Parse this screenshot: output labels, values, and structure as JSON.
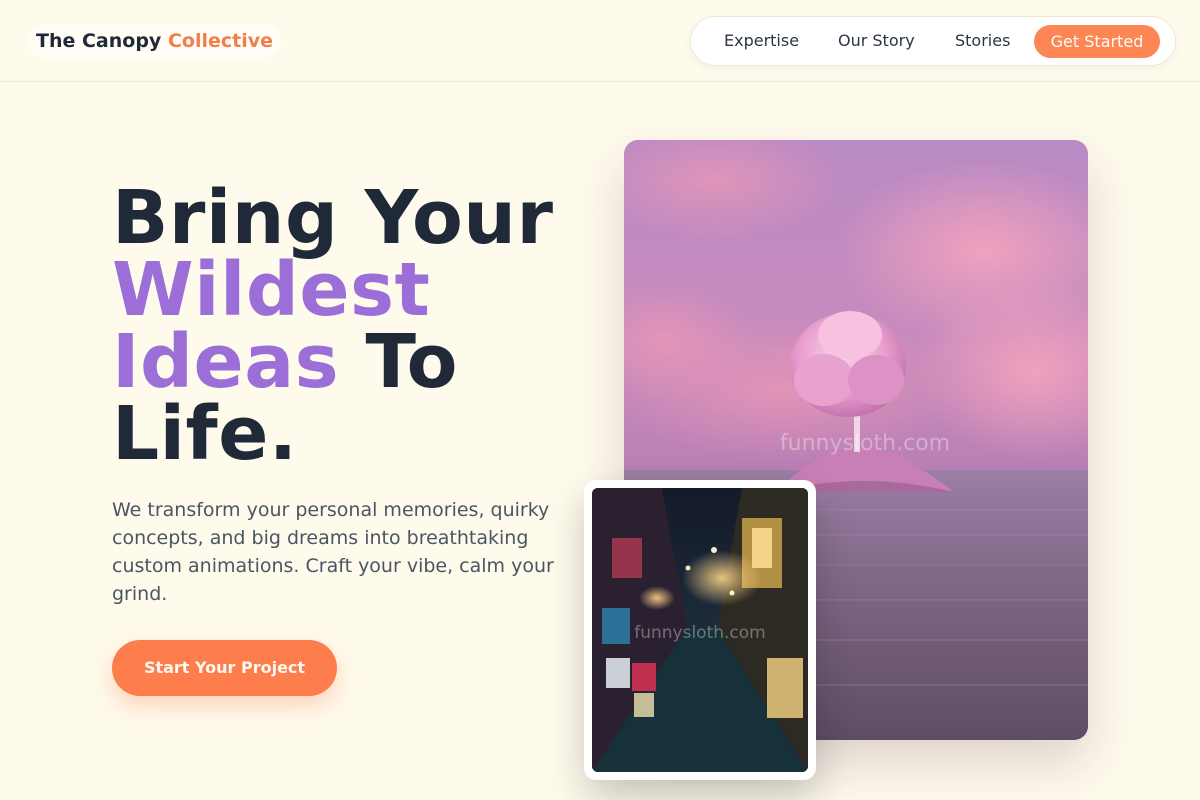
{
  "brand": {
    "name_main": "The Canopy",
    "name_accent": "Collective"
  },
  "nav": {
    "items": [
      {
        "label": "Expertise"
      },
      {
        "label": "Our Story"
      },
      {
        "label": "Stories"
      }
    ],
    "cta_label": "Get Started"
  },
  "hero": {
    "headline_line1": "Bring Your",
    "headline_accent1": "Wildest",
    "headline_accent2": "Ideas",
    "headline_line3_rest": "To",
    "headline_line4": "Life.",
    "subcopy": "We transform your personal memories, quirky concepts, and big dreams into breathtaking custom animations. Craft your vibe, calm your grind.",
    "cta_label": "Start Your Project"
  },
  "images": {
    "main": {
      "subject": "pink-tree-island-sunset",
      "watermark": "funnysloth.com"
    },
    "inset": {
      "subject": "neon-alley-night",
      "watermark": "funnysloth.com"
    }
  },
  "colors": {
    "background": "#fefaec",
    "accent_orange": "#fd7d4d",
    "accent_purple": "#9b6fd7",
    "text_dark": "#1f2937"
  }
}
